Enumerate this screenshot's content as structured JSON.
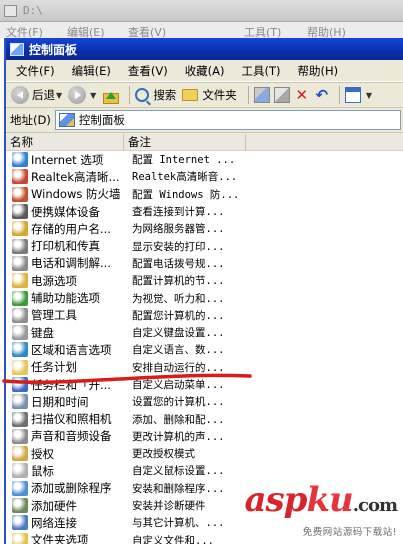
{
  "background_window": {
    "title": "D:\\",
    "menu": [
      "文件(F)",
      "编辑(E)",
      "查看(V)",
      "工具(T)",
      "帮助(H)"
    ]
  },
  "window": {
    "title": "控制面板"
  },
  "menubar": [
    "文件(F)",
    "编辑(E)",
    "查看(V)",
    "收藏(A)",
    "工具(T)",
    "帮助(H)"
  ],
  "toolbar": {
    "back": "后退",
    "search": "搜索",
    "folders": "文件夹"
  },
  "address": {
    "label": "地址(D)",
    "value": "控制面板"
  },
  "columns": {
    "name": "名称",
    "note": "备注"
  },
  "items": [
    {
      "name": "Internet 选项",
      "note": "配置 Internet ...",
      "icon": "globe-icon",
      "color": "#2f7fd9"
    },
    {
      "name": "Realtek高清晰...",
      "note": "Realtek高清晰音...",
      "icon": "speaker-icon",
      "color": "#c94632"
    },
    {
      "name": "Windows 防火墙",
      "note": "配置 Windows 防...",
      "icon": "firewall-icon",
      "color": "#c4512a"
    },
    {
      "name": "便携媒体设备",
      "note": "查看连接到计算...",
      "icon": "media-device-icon",
      "color": "#5a5a5a"
    },
    {
      "name": "存储的用户名...",
      "note": "为网络服务器管...",
      "icon": "key-icon",
      "color": "#d6a531"
    },
    {
      "name": "打印机和传真",
      "note": "显示安装的打印...",
      "icon": "printer-icon",
      "color": "#7a7a7a"
    },
    {
      "name": "电话和调制解...",
      "note": "配置电话拨号规...",
      "icon": "phone-icon",
      "color": "#8c8c8c"
    },
    {
      "name": "电源选项",
      "note": "配置计算机的节...",
      "icon": "power-icon",
      "color": "#e0b23e"
    },
    {
      "name": "辅助功能选项",
      "note": "为视觉、听力和...",
      "icon": "accessibility-icon",
      "color": "#3b9c3b"
    },
    {
      "name": "管理工具",
      "note": "配置您计算机的...",
      "icon": "admin-tools-icon",
      "color": "#8f8f8f"
    },
    {
      "name": "键盘",
      "note": "自定义键盘设置...",
      "icon": "keyboard-icon",
      "color": "#9a9a9a"
    },
    {
      "name": "区域和语言选项",
      "note": "自定义语言、数...",
      "icon": "region-icon",
      "color": "#2f89c9"
    },
    {
      "name": "任务计划",
      "note": "安排自动运行的...",
      "icon": "scheduled-tasks-icon",
      "color": "#e5c45a"
    },
    {
      "name": "任务栏和「开...",
      "note": "自定义启动菜单...",
      "icon": "taskbar-icon",
      "color": "#3a6bc4"
    },
    {
      "name": "日期和时间",
      "note": "设置您的计算机...",
      "icon": "clock-icon",
      "color": "#7a8fb0"
    },
    {
      "name": "扫描仪和照相机",
      "note": "添加、删除和配...",
      "icon": "scanner-icon",
      "color": "#6f6f6f"
    },
    {
      "name": "声音和音频设备",
      "note": "更改计算机的声...",
      "icon": "sound-icon",
      "color": "#8c8c8c"
    },
    {
      "name": "授权",
      "note": "更改授权模式",
      "icon": "license-icon",
      "color": "#d4a84a"
    },
    {
      "name": "鼠标",
      "note": "自定义鼠标设置...",
      "icon": "mouse-icon",
      "color": "#b0b0b0"
    },
    {
      "name": "添加或删除程序",
      "note": "安装和删除程序...",
      "icon": "add-remove-icon",
      "color": "#4d8fd6"
    },
    {
      "name": "添加硬件",
      "note": "安装并诊断硬件",
      "icon": "hardware-icon",
      "color": "#6c8a5a"
    },
    {
      "name": "网络连接",
      "note": "与其它计算机、...",
      "icon": "network-icon",
      "color": "#4a7cc4"
    },
    {
      "name": "文件夹选项",
      "note": "自定义文件和...",
      "icon": "folder-options-icon",
      "color": "#e2bf4b"
    }
  ],
  "watermark": {
    "brand_a": "asp",
    "brand_b": "ku",
    "brand_c": ".com",
    "sub": "免费网站源码下载站!"
  }
}
